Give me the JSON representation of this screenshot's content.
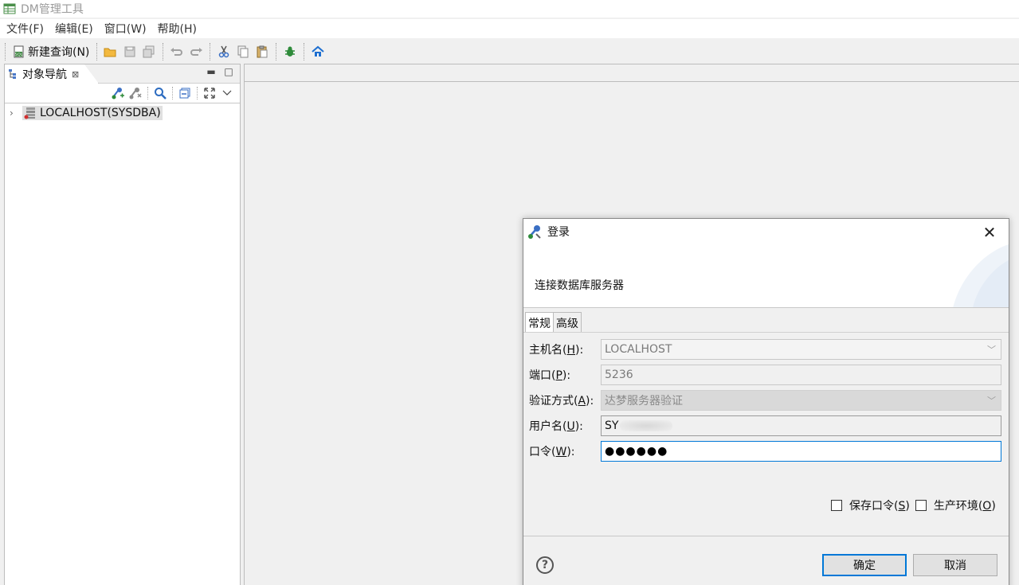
{
  "window": {
    "title": "DM管理工具"
  },
  "menu": [
    "文件(F)",
    "编辑(E)",
    "窗口(W)",
    "帮助(H)"
  ],
  "toolbar": {
    "new_query_label": "新建查询(N)"
  },
  "navigator": {
    "tab_label": "对象导航",
    "tree": [
      {
        "label": "LOCALHOST(SYSDBA)",
        "expanded": false
      }
    ]
  },
  "dialog": {
    "title": "登录",
    "description": "连接数据库服务器",
    "tabs": [
      "常规",
      "高级"
    ],
    "fields": {
      "host": {
        "label_pre": "主机名(",
        "mnemonic": "H",
        "label_post": "):",
        "value": "LOCALHOST"
      },
      "port": {
        "label_pre": "端口(",
        "mnemonic": "P",
        "label_post": "):",
        "value": "5236"
      },
      "auth": {
        "label_pre": "验证方式(",
        "mnemonic": "A",
        "label_post": "):",
        "value": "达梦服务器验证"
      },
      "user": {
        "label_pre": "用户名(",
        "mnemonic": "U",
        "label_post": "):",
        "value": "SY"
      },
      "password": {
        "label_pre": "口令(",
        "mnemonic": "W",
        "label_post": "):",
        "value": "●●●●●●"
      }
    },
    "checkboxes": {
      "save_password": {
        "label_pre": "保存口令(",
        "mnemonic": "S",
        "label_post": ")",
        "checked": false
      },
      "production": {
        "label_pre": "生产环境(",
        "mnemonic": "O",
        "label_post": ")",
        "checked": false
      }
    },
    "buttons": {
      "ok": "确定",
      "cancel": "取消"
    }
  },
  "colors": {
    "accent": "#0078d7",
    "panel_bg": "#f0f0f0"
  }
}
